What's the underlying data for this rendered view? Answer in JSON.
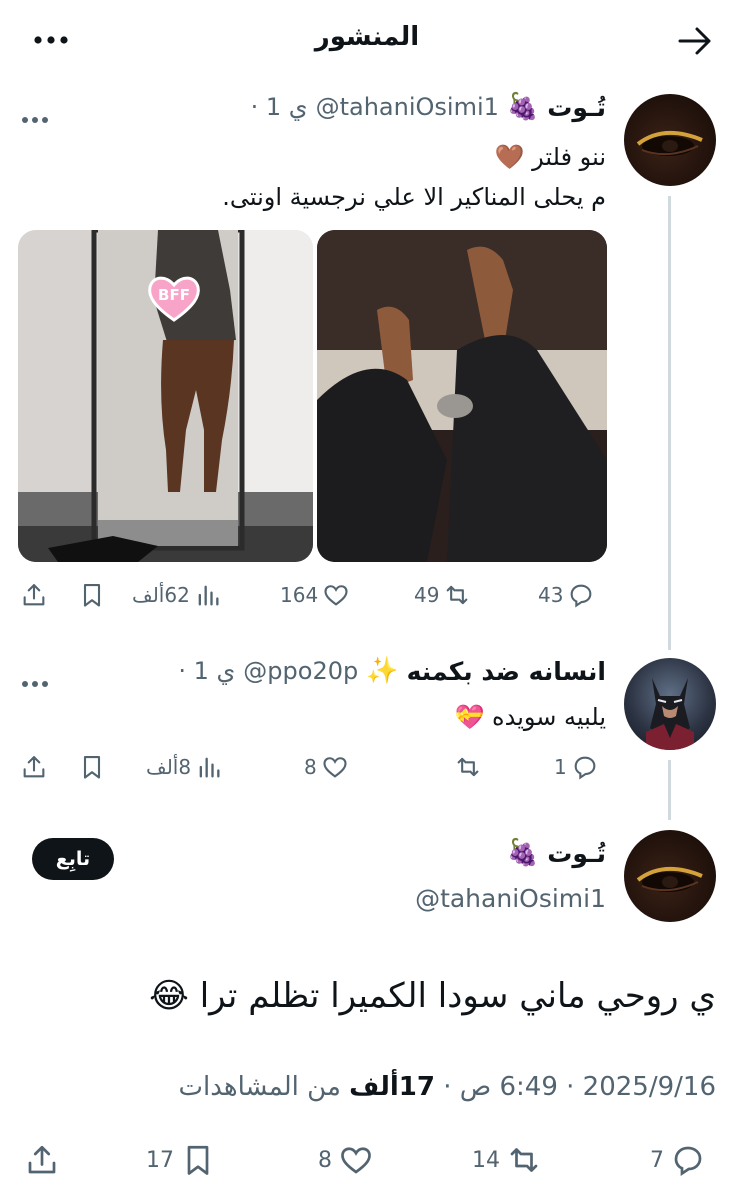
{
  "header": {
    "title": "المنشور"
  },
  "tweet1": {
    "name": "تُـوت",
    "name_emoji": "🍇",
    "handle": "‎@tahaniOsimi1",
    "time": "ي 1 ·",
    "line1": "ننو فلتر",
    "line1_emoji": "🤎",
    "line2": "م يحلى المناكير الا علي نرجسية اونتى.",
    "sticker": "BFF",
    "stats": {
      "replies": "43",
      "reposts": "49",
      "likes": "164",
      "views": "62ألف"
    }
  },
  "tweet2": {
    "name": "انسانه ضد بكمنه",
    "name_emoji": "✨",
    "handle": "‎@ppo20p",
    "time": "ي 1 ·",
    "text": "يلبيه سويده",
    "text_emoji": "💝",
    "stats": {
      "replies": "1",
      "reposts": "",
      "likes": "8",
      "views": "8ألف"
    }
  },
  "main_tweet": {
    "name": "تُـوت",
    "name_emoji": "🍇",
    "handle": "@tahaniOsimi1",
    "follow_label": "تابِع",
    "text": "ي روحي ماني سودا الكميرا تظلم ترا",
    "text_emoji": "😂",
    "date": "2025/9/16 · 6:49 ص · ",
    "views_count": "17ألف",
    "views_label": " من المشاهدات",
    "stats": {
      "replies": "7",
      "reposts": "14",
      "likes": "8",
      "bookmarks": "17"
    }
  },
  "icons": {
    "back": "arrow-right-icon",
    "more": "more-horizontal-icon",
    "reply": "reply-bubble-icon",
    "repost": "repost-icon",
    "like": "heart-icon",
    "views": "views-bar-chart-icon",
    "bookmark": "bookmark-icon",
    "share": "share-upload-icon"
  },
  "colors": {
    "text": "#0f1419",
    "secondary": "#536471",
    "thread_line": "#cfd9de",
    "follow_bg": "#0f1419"
  }
}
